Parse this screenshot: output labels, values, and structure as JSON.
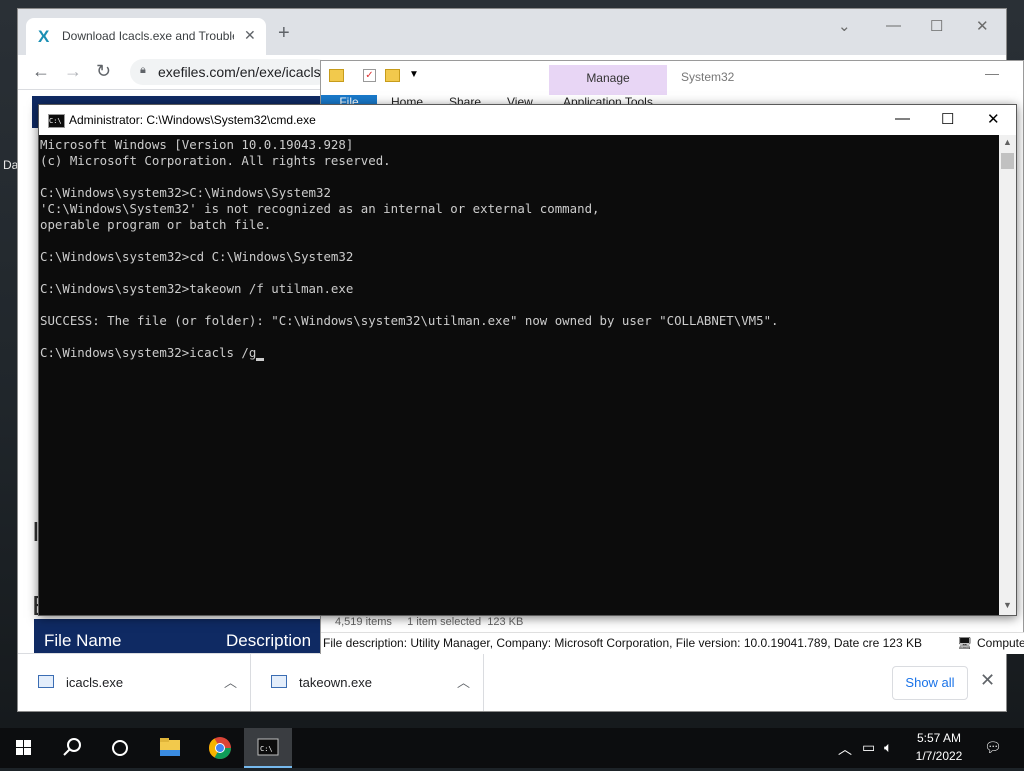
{
  "desktop": {
    "fragments": [
      "Da"
    ]
  },
  "browser": {
    "tab_title": "Download Icacls.exe and Troubleshoot",
    "tab_favicon": "X",
    "url": "exefiles.com/en/exe/icacls",
    "page_letters": [
      "I",
      "E"
    ],
    "table_headers": [
      "File Name",
      "Description"
    ],
    "downloads": [
      {
        "name": "icacls.exe"
      },
      {
        "name": "takeown.exe"
      }
    ],
    "show_all_label": "Show all"
  },
  "explorer": {
    "manage_label": "Manage",
    "title": "System32",
    "ribbon_tabs": [
      "File",
      "Home",
      "Share",
      "View",
      "Application Tools"
    ],
    "status": "4,519 items     1 item selected  123 KB",
    "description": "File description: Utility Manager, Company: Microsoft Corporation, File version: 10.0.19041.789, Date cre 123 KB",
    "side_label": "Compute"
  },
  "cmd": {
    "title": "Administrator: C:\\Windows\\System32\\cmd.exe",
    "lines": [
      "Microsoft Windows [Version 10.0.19043.928]",
      "(c) Microsoft Corporation. All rights reserved.",
      "",
      "C:\\Windows\\system32>C:\\Windows\\System32",
      "'C:\\Windows\\System32' is not recognized as an internal or external command,",
      "operable program or batch file.",
      "",
      "C:\\Windows\\system32>cd C:\\Windows\\System32",
      "",
      "C:\\Windows\\system32>takeown /f utilman.exe",
      "",
      "SUCCESS: The file (or folder): \"C:\\Windows\\system32\\utilman.exe\" now owned by user \"COLLABNET\\VM5\".",
      "",
      "C:\\Windows\\system32>icacls /g"
    ]
  },
  "taskbar": {
    "time": "5:57 AM",
    "date": "1/7/2022",
    "icons": [
      "windows-start-icon",
      "search-icon",
      "task-view-icon",
      "file-explorer-icon",
      "chrome-icon",
      "cmd-icon"
    ]
  },
  "colors": {
    "console_bg": "#0c0c0c",
    "console_fg": "#cccccc",
    "site_navy": "#0f2a63",
    "manage_tab": "#e8d6f5",
    "file_tab": "#1979ca"
  }
}
